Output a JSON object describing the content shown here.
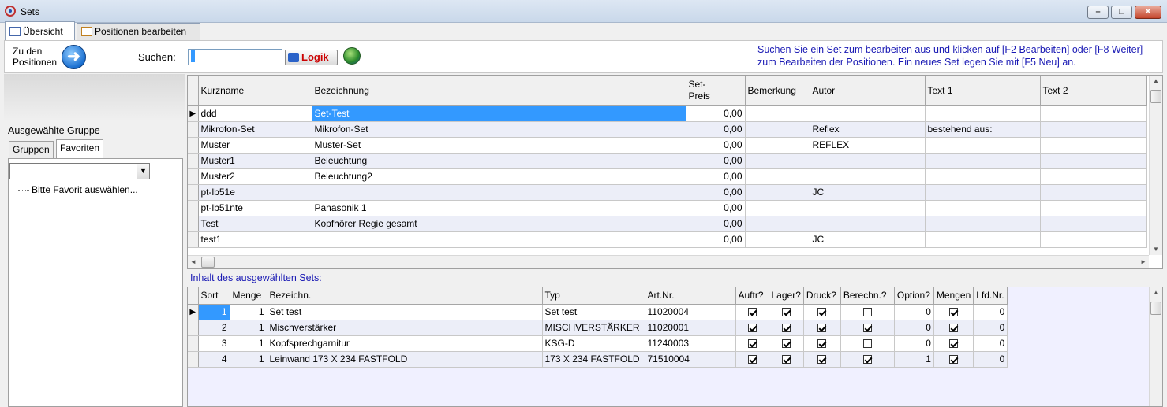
{
  "window": {
    "title": "Sets",
    "minimize_glyph": "–",
    "maximize_glyph": "□",
    "close_glyph": "✕"
  },
  "tabs": [
    {
      "label": "Übersicht",
      "active": true,
      "icon": "list-icon"
    },
    {
      "label": "Positionen bearbeiten",
      "active": false,
      "icon": "edit-icon"
    }
  ],
  "toolbar": {
    "goto_line1": "Zu den",
    "goto_line2": "Positionen",
    "goto_icon": "arrow-right-icon",
    "arrow_glyph": "➜",
    "search_label": "Suchen:",
    "search_value": "",
    "logik_label": "Logik",
    "globe_icon": "globe-icon",
    "help_text": "Suchen Sie ein Set zum bearbeiten aus und klicken auf [F2 Bearbeiten] oder [F8 Weiter] zum Bearbeiten der Positionen. Ein neues Set legen Sie mit [F5 Neu] an."
  },
  "left_panel": {
    "group_label": "Ausgewählte Gruppe",
    "subtabs": [
      {
        "label": "Gruppen",
        "active": false
      },
      {
        "label": "Favoriten",
        "active": true
      }
    ],
    "combo_value": "",
    "combo_arrow": "▼",
    "tree_item": "Bitte Favorit auswählen..."
  },
  "sets_grid": {
    "columns": [
      "Kurzname",
      "Bezeichnung",
      "Set-\nPreis",
      "Bemerkung",
      "Autor",
      "Text 1",
      "Text 2"
    ],
    "rows": [
      {
        "kurzname": "ddd",
        "bezeichnung": "Set-Test",
        "preis": "0,00",
        "bemerkung": "",
        "autor": "",
        "text1": "",
        "text2": "",
        "current": true
      },
      {
        "kurzname": "Mikrofon-Set",
        "bezeichnung": "Mikrofon-Set",
        "preis": "0,00",
        "bemerkung": "",
        "autor": "Reflex",
        "text1": "bestehend aus:",
        "text2": ""
      },
      {
        "kurzname": "Muster",
        "bezeichnung": "Muster-Set",
        "preis": "0,00",
        "bemerkung": "",
        "autor": "REFLEX",
        "text1": "",
        "text2": ""
      },
      {
        "kurzname": "Muster1",
        "bezeichnung": "Beleuchtung",
        "preis": "0,00",
        "bemerkung": "",
        "autor": "",
        "text1": "",
        "text2": ""
      },
      {
        "kurzname": "Muster2",
        "bezeichnung": "Beleuchtung2",
        "preis": "0,00",
        "bemerkung": "",
        "autor": "",
        "text1": "",
        "text2": ""
      },
      {
        "kurzname": "pt-lb51e",
        "bezeichnung": "",
        "preis": "0,00",
        "bemerkung": "",
        "autor": "JC",
        "text1": "",
        "text2": ""
      },
      {
        "kurzname": "pt-lb51nte",
        "bezeichnung": "Panasonik 1",
        "preis": "0,00",
        "bemerkung": "",
        "autor": "",
        "text1": "",
        "text2": ""
      },
      {
        "kurzname": "Test",
        "bezeichnung": "Kopfhörer Regie gesamt",
        "preis": "0,00",
        "bemerkung": "",
        "autor": "",
        "text1": "",
        "text2": ""
      },
      {
        "kurzname": "test1",
        "bezeichnung": "",
        "preis": "0,00",
        "bemerkung": "",
        "autor": "JC",
        "text1": "",
        "text2": ""
      }
    ]
  },
  "section_label": "Inhalt des ausgewählten Sets:",
  "positions_grid": {
    "columns": [
      "Sort",
      "Menge",
      "Bezeichn.",
      "Typ",
      "Art.Nr.",
      "Auftr?",
      "Lager?",
      "Druck?",
      "Berechn.?",
      "Option?",
      "Mengen",
      "Lfd.Nr."
    ],
    "rows": [
      {
        "sort": "1",
        "menge": "1",
        "bez": "Set test",
        "typ": "Set test",
        "artnr": "11020004",
        "auftr": true,
        "lager": true,
        "druck": true,
        "berechn": false,
        "option": "0",
        "mengen": true,
        "lfd": "0",
        "current": true
      },
      {
        "sort": "2",
        "menge": "1",
        "bez": "Mischverstärker",
        "typ": "MISCHVERSTÄRKER",
        "artnr": "11020001",
        "auftr": true,
        "lager": true,
        "druck": true,
        "berechn": true,
        "option": "0",
        "mengen": true,
        "lfd": "0"
      },
      {
        "sort": "3",
        "menge": "1",
        "bez": "Kopfsprechgarnitur",
        "typ": "KSG-D",
        "artnr": "11240003",
        "auftr": true,
        "lager": true,
        "druck": true,
        "berechn": false,
        "option": "0",
        "mengen": true,
        "lfd": "0"
      },
      {
        "sort": "4",
        "menge": "1",
        "bez": "Leinwand 173 X 234 FASTFOLD",
        "typ": "173 X 234 FASTFOLD",
        "artnr": "71510004",
        "auftr": true,
        "lager": true,
        "druck": true,
        "berechn": true,
        "option": "1",
        "mengen": true,
        "lfd": "0"
      }
    ]
  }
}
